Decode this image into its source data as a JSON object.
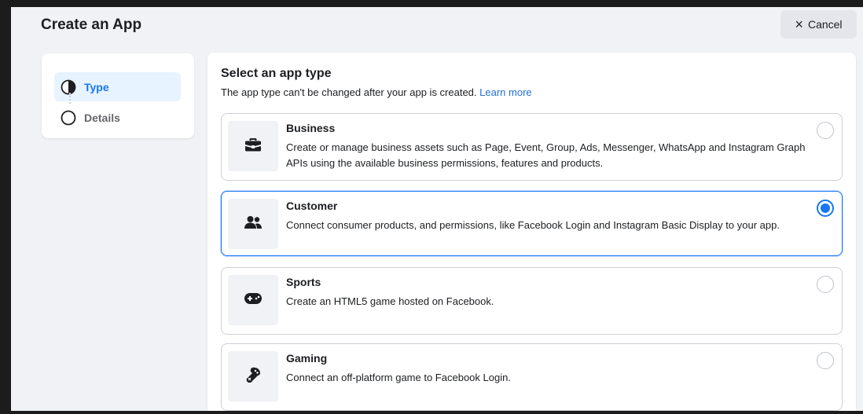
{
  "dialog": {
    "title": "Create an App",
    "cancel_label": "Cancel"
  },
  "steps": [
    {
      "label": "Type",
      "state": "active"
    },
    {
      "label": "Details",
      "state": "inactive"
    }
  ],
  "main": {
    "heading": "Select an app type",
    "subtitle": "The app type can't be changed after your app is created.",
    "learn_more": "Learn more",
    "options": [
      {
        "title": "Business",
        "description": "Create or manage business assets such as Page, Event, Group, Ads, Messenger, WhatsApp and Instagram Graph APIs using the available business permissions, features and products.",
        "icon": "briefcase-icon",
        "selected": false
      },
      {
        "title": "Customer",
        "description": "Connect consumer products, and permissions, like Facebook Login and Instagram Basic Display to your app.",
        "icon": "people-icon",
        "selected": true
      },
      {
        "title": "Sports",
        "description": "Create an HTML5 game hosted on Facebook.",
        "icon": "gamepad-icon",
        "selected": false
      },
      {
        "title": "Gaming",
        "description": "Connect an off-platform game to Facebook Login.",
        "icon": "joystick-icon",
        "selected": false
      }
    ]
  },
  "colors": {
    "accent": "#1877f2",
    "link": "#216fdb",
    "background": "#f0f2f5",
    "border": "#ccd0d5"
  }
}
